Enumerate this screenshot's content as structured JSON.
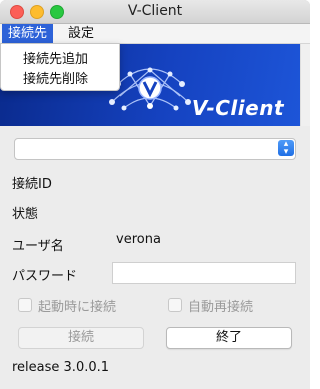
{
  "window": {
    "title": "V-Client"
  },
  "menubar": {
    "connect": "接続先",
    "settings": "設定"
  },
  "dropdown": {
    "add": "接続先追加",
    "delete": "接続先削除"
  },
  "banner": {
    "brand": "V-Client"
  },
  "form": {
    "connection_select": "",
    "connection_id_label": "接続ID",
    "connection_id_value": "",
    "status_label": "状態",
    "status_value": "",
    "user_label": "ユーザ名",
    "user_value": "verona",
    "password_label": "パスワード",
    "password_value": ""
  },
  "options": {
    "startup_connect": "起動時に接続",
    "auto_reconnect": "自動再接続"
  },
  "buttons": {
    "connect": "接続",
    "quit": "終了"
  },
  "footer": {
    "release": "release 3.0.0.1"
  },
  "colors": {
    "menu_highlight": "#2d62d8",
    "banner": "#1542c0",
    "disabled_text": "#9a9a9a"
  }
}
